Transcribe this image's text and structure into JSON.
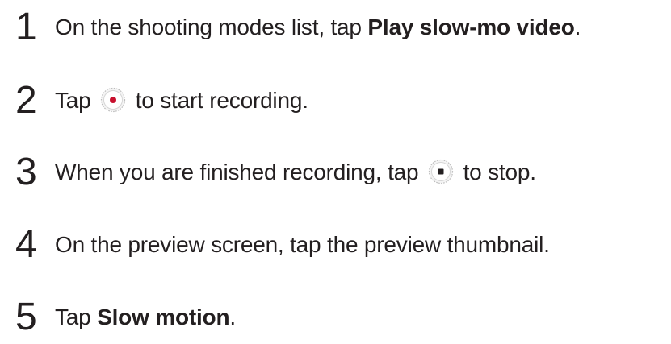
{
  "steps": [
    {
      "number": "1",
      "text_before": "On the shooting modes list, tap ",
      "bold": "Play slow-mo video",
      "text_after": "."
    },
    {
      "number": "2",
      "text_before": "Tap ",
      "icon": "record-button-icon",
      "text_after": " to start recording."
    },
    {
      "number": "3",
      "text_before": "When you are finished recording, tap ",
      "icon": "stop-button-icon",
      "text_after": " to stop."
    },
    {
      "number": "4",
      "text_before": "On the preview screen, tap the preview thumbnail.",
      "text_after": ""
    },
    {
      "number": "5",
      "text_before": "Tap ",
      "bold": "Slow motion",
      "text_after": "."
    }
  ],
  "colors": {
    "text": "#231f20",
    "record_dot": "#c8102e",
    "stop_square": "#231f20",
    "button_ring": "#bdbdbd"
  }
}
